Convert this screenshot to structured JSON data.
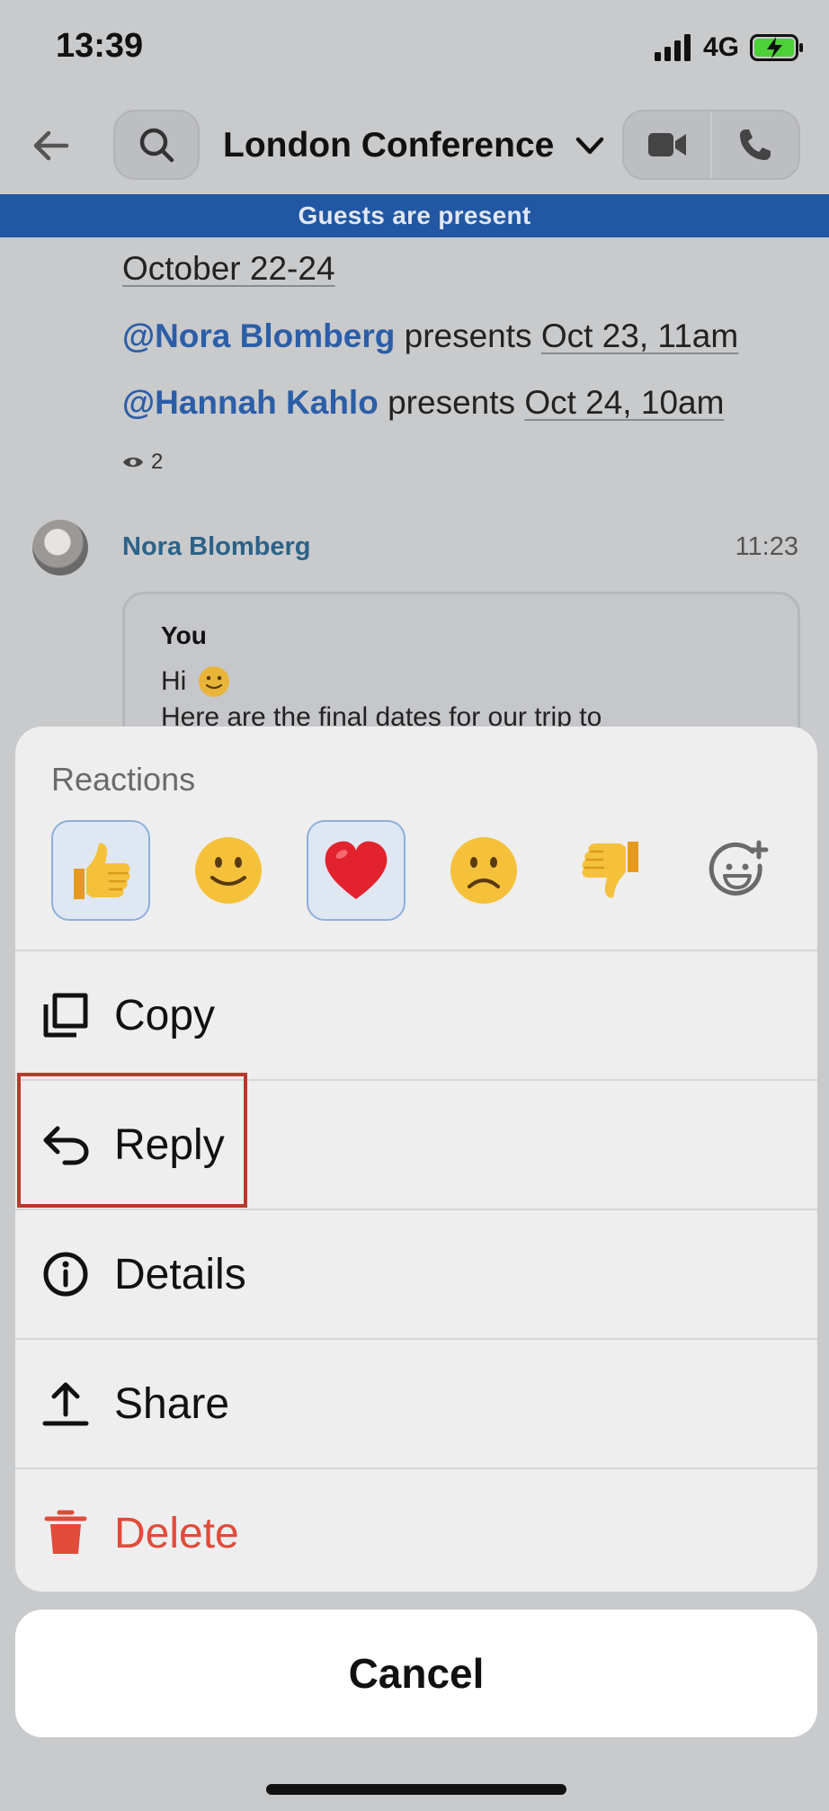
{
  "status_bar": {
    "time": "13:39",
    "network": "4G",
    "battery_color": "#4cd137"
  },
  "header": {
    "title": "London Conference"
  },
  "banner": {
    "text": "Guests are present",
    "color": "#2157a3"
  },
  "chat": {
    "line1": "October 22-24",
    "line2": {
      "mention": "@Nora Blomberg",
      "middle": " presents ",
      "date": "Oct 23, 11am"
    },
    "line3": {
      "mention": "@Hannah Kahlo",
      "middle": " presents ",
      "date": "Oct 24, 10am"
    },
    "seen_count": "2",
    "message": {
      "sender": "Nora Blomberg",
      "time": "11:23",
      "quote": {
        "author": "You",
        "greeting": "Hi",
        "text": "Here are the final dates for our trip to"
      }
    }
  },
  "sheet": {
    "reactions_label": "Reactions",
    "reactions": [
      {
        "emoji": "👍",
        "name": "thumbs-up",
        "selected": true
      },
      {
        "emoji": "🙂",
        "name": "smile",
        "selected": false
      },
      {
        "emoji": "❤️",
        "name": "heart",
        "selected": true
      },
      {
        "emoji": "☹️",
        "name": "frown",
        "selected": false
      },
      {
        "emoji": "👎",
        "name": "thumbs-down",
        "selected": false
      },
      {
        "emoji": "",
        "name": "add-reaction",
        "selected": false
      }
    ],
    "actions": {
      "copy": "Copy",
      "reply": "Reply",
      "details": "Details",
      "share": "Share",
      "delete": "Delete"
    },
    "danger_color": "#e14b3a",
    "highlight_color": "#b63a2b"
  },
  "cancel_label": "Cancel"
}
